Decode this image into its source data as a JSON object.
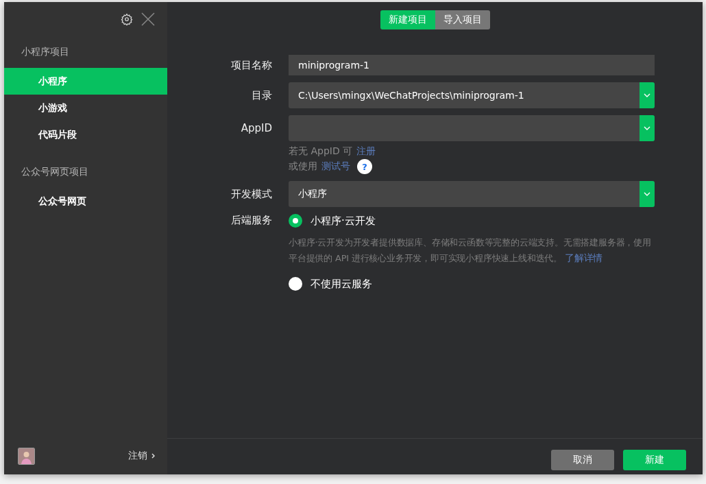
{
  "sidebar": {
    "groups": [
      {
        "title": "小程序项目",
        "items": [
          {
            "label": "小程序",
            "selected": true
          },
          {
            "label": "小游戏",
            "selected": false
          },
          {
            "label": "代码片段",
            "selected": false
          }
        ]
      },
      {
        "title": "公众号网页项目",
        "items": [
          {
            "label": "公众号网页",
            "selected": false
          }
        ]
      }
    ],
    "logout": "注销"
  },
  "tabs": [
    {
      "label": "新建项目",
      "selected": true
    },
    {
      "label": "导入项目",
      "selected": false
    }
  ],
  "form": {
    "fields": [
      {
        "kind": "text",
        "label": "项目名称",
        "value": "miniprogram-1"
      },
      {
        "kind": "select",
        "label": "目录",
        "value": "C:\\Users\\mingx\\WeChatProjects\\miniprogram-1"
      },
      {
        "kind": "select",
        "label": "AppID"
      },
      {
        "kind": "hint",
        "lines": [
          {
            "text": "若无 AppID 可",
            "link": "注册"
          },
          {
            "text": "或使用",
            "link": "测试号",
            "help": "?"
          }
        ]
      },
      {
        "kind": "select",
        "label": "开发模式",
        "value": "小程序"
      },
      {
        "kind": "radio",
        "label": "后端服务",
        "options": [
          {
            "label": "小程序·云开发",
            "selected": true,
            "description": "小程序·云开发为开发者提供数据库、存储和云函数等完整的云端支持。无需搭建服务器，使用平台提供的 API 进行核心业务开发，即可实现小程序快速上线和迭代。",
            "link": "了解详情"
          },
          {
            "label": "不使用云服务",
            "selected": false
          }
        ]
      }
    ]
  },
  "buttons": [
    {
      "label": "取消",
      "kind": "secondary"
    },
    {
      "label": "新建",
      "kind": "primary"
    }
  ]
}
